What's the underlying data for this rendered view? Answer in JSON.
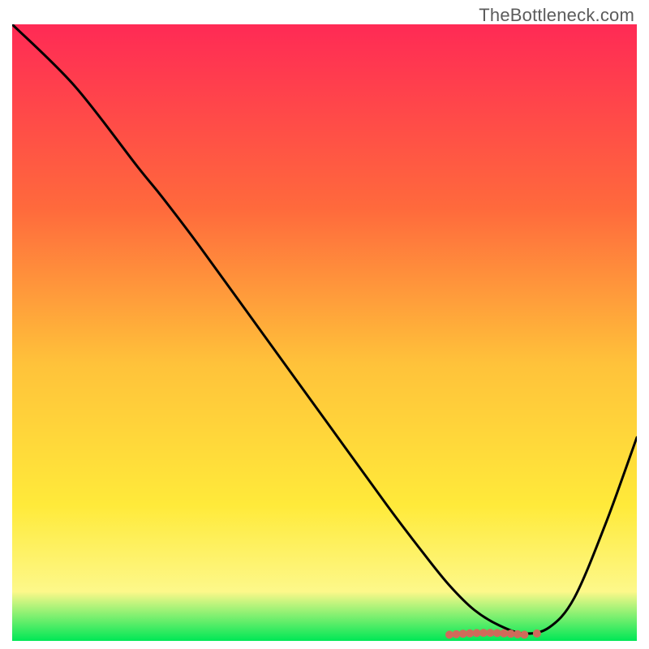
{
  "watermark": "TheBottleneck.com",
  "chart_data": {
    "type": "line",
    "title": "",
    "xlabel": "",
    "ylabel": "",
    "xlim": [
      0,
      100
    ],
    "ylim": [
      0,
      100
    ],
    "grid": false,
    "legend": false,
    "gradient": {
      "top": "#ff2a55",
      "mid1": "#ff6a3c",
      "mid2": "#ffc23a",
      "mid3": "#ffea3a",
      "mid4": "#fdf88a",
      "bottom": "#00e756"
    },
    "series": [
      {
        "name": "bottleneck-curve",
        "color": "#000000",
        "x": [
          0,
          10,
          20,
          24,
          30,
          40,
          50,
          60,
          66,
          70,
          74,
          78,
          82,
          86,
          90,
          95,
          100
        ],
        "y": [
          100,
          90,
          77,
          72,
          64,
          50,
          36,
          22,
          14,
          9,
          5,
          2.5,
          1.2,
          2.2,
          7,
          19,
          33
        ]
      }
    ],
    "marker_cluster": {
      "name": "optimal-range",
      "color": "#d06a5a",
      "cx_range": [
        70,
        82
      ],
      "count": 12,
      "y": 1.0,
      "outlier_x": 84,
      "outlier_y": 1.2
    }
  }
}
